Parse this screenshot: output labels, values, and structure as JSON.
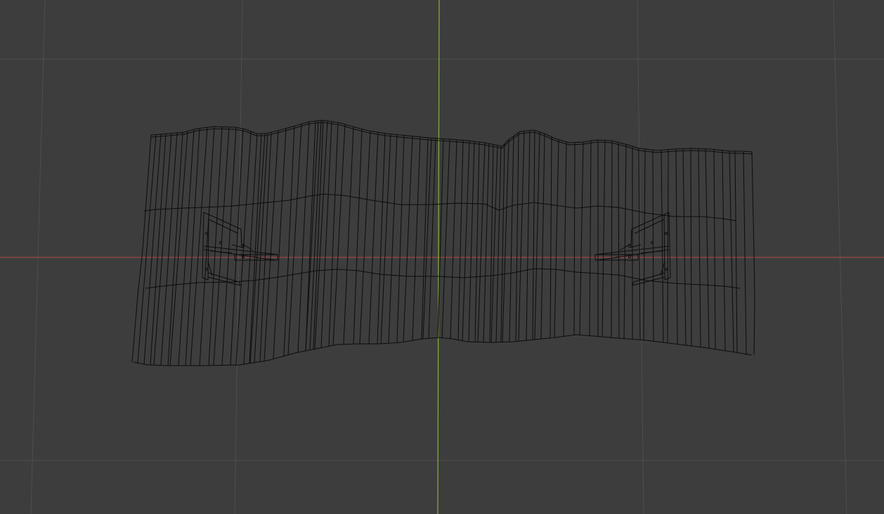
{
  "viewport": {
    "mode": "wireframe",
    "view": "front-orthographic",
    "colors": {
      "background": "#3d3d3d",
      "grid": "#4e4e4e",
      "x_axis": "#b54a4a",
      "z_axis": "#86b03c",
      "wire": "#0c0c0c"
    }
  },
  "scene": {
    "objects": [
      {
        "name": "corrugated-wall-mesh",
        "kind": "mesh"
      },
      {
        "name": "shelf-bracket-left",
        "kind": "mesh"
      },
      {
        "name": "shelf-bracket-right",
        "kind": "mesh"
      }
    ]
  }
}
